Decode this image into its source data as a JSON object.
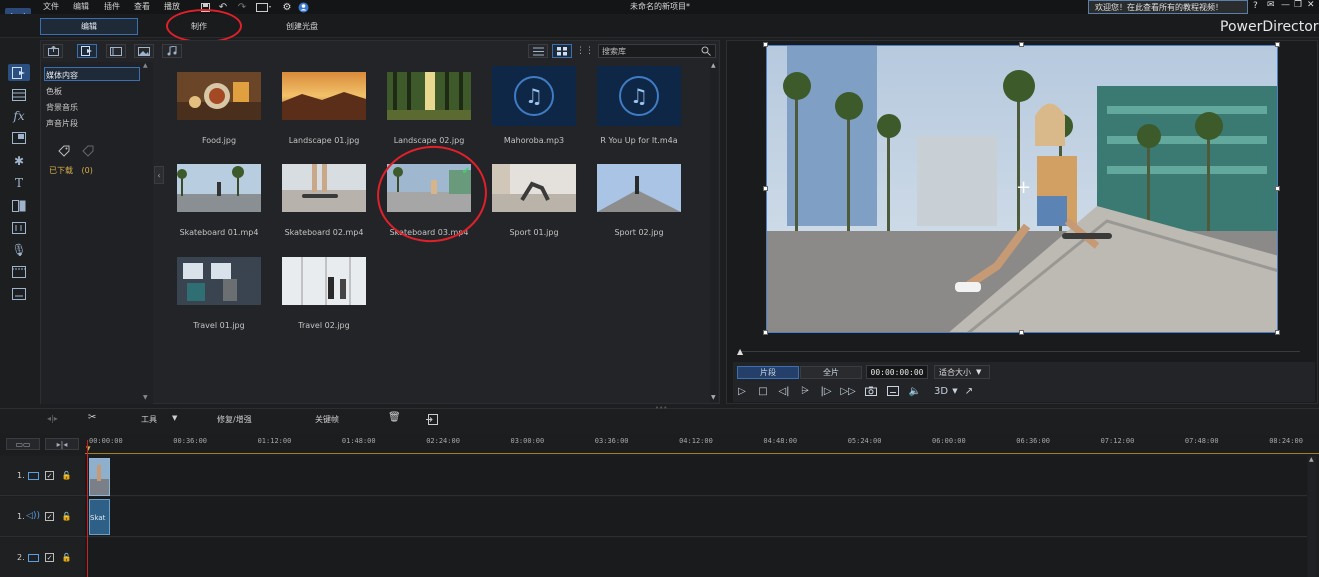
{
  "menu": {
    "file": "文件",
    "edit": "编辑",
    "plugins": "插件",
    "view": "查看",
    "playback": "播放"
  },
  "window": {
    "title": "未命名的新项目*",
    "welcome": "欢迎您！在此查看所有的教程视频！",
    "help": "?",
    "brand": "PowerDirector"
  },
  "modes": {
    "edit": "编辑",
    "produce": "制作",
    "disc": "创建光盘"
  },
  "library": {
    "search_placeholder": "搜索库",
    "categories": [
      "媒体内容",
      "色板",
      "背景音乐",
      "声音片段"
    ],
    "downloaded": "已下载",
    "downloaded_count": "(0)",
    "items": [
      {
        "name": "Food.jpg",
        "kind": "image"
      },
      {
        "name": "Landscape 01.jpg",
        "kind": "image"
      },
      {
        "name": "Landscape 02.jpg",
        "kind": "image"
      },
      {
        "name": "Mahoroba.mp3",
        "kind": "audio"
      },
      {
        "name": "R You Up for It.m4a",
        "kind": "audio"
      },
      {
        "name": "Skateboard 01.mp4",
        "kind": "video"
      },
      {
        "name": "Skateboard 02.mp4",
        "kind": "video"
      },
      {
        "name": "Skateboard 03.mp4",
        "kind": "video"
      },
      {
        "name": "Sport 01.jpg",
        "kind": "image"
      },
      {
        "name": "Sport 02.jpg",
        "kind": "image"
      },
      {
        "name": "Travel 01.jpg",
        "kind": "image"
      },
      {
        "name": "Travel 02.jpg",
        "kind": "image"
      }
    ]
  },
  "preview": {
    "clip_tab": "片段",
    "movie_tab": "全片",
    "timecode": "00:00:00:00",
    "fit": "适合大小",
    "threed": "3D"
  },
  "timeline": {
    "tools": "工具",
    "fix": "修复/增强",
    "keyframe": "关键帧",
    "ticks": [
      "00:00:00",
      "00:36:00",
      "01:12:00",
      "01:48:00",
      "02:24:00",
      "03:00:00",
      "03:36:00",
      "04:12:00",
      "04:48:00",
      "05:24:00",
      "06:00:00",
      "06:36:00",
      "07:12:00",
      "07:48:00",
      "08:24:00"
    ],
    "tracks": [
      {
        "num": "1.",
        "type": "video"
      },
      {
        "num": "1.",
        "type": "audio"
      },
      {
        "num": "2.",
        "type": "video"
      }
    ],
    "audio_clip_label": "Skat"
  },
  "colors": {
    "accent": "#3a6fb0",
    "annotation": "#e0202a",
    "playhead": "#d02020"
  }
}
